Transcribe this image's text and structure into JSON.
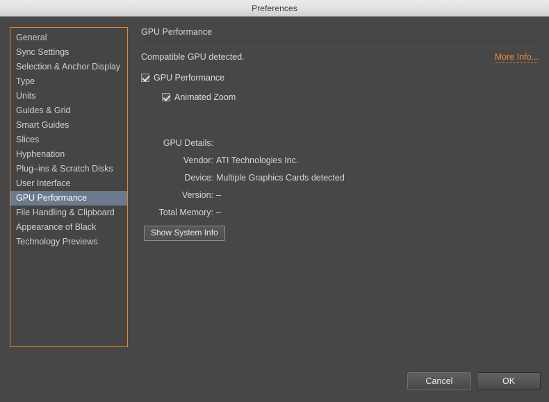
{
  "window": {
    "title": "Preferences"
  },
  "sidebar": {
    "selected": "GPU Performance",
    "items": [
      {
        "label": "General"
      },
      {
        "label": "Sync Settings"
      },
      {
        "label": "Selection & Anchor Display"
      },
      {
        "label": "Type"
      },
      {
        "label": "Units"
      },
      {
        "label": "Guides & Grid"
      },
      {
        "label": "Smart Guides"
      },
      {
        "label": "Slices"
      },
      {
        "label": "Hyphenation"
      },
      {
        "label": "Plug–ins & Scratch Disks"
      },
      {
        "label": "User Interface"
      },
      {
        "label": "GPU Performance"
      },
      {
        "label": "File Handling & Clipboard"
      },
      {
        "label": "Appearance of Black"
      },
      {
        "label": "Technology Previews"
      }
    ]
  },
  "main": {
    "header": "GPU Performance",
    "status_text": "Compatible GPU detected.",
    "more_info_label": "More Info...",
    "checkboxes": [
      {
        "label": "GPU Performance",
        "checked": true
      },
      {
        "label": "Animated Zoom",
        "checked": true
      }
    ],
    "details_title": "GPU Details:",
    "details": [
      {
        "label": "Vendor:",
        "value": "ATI Technologies Inc."
      },
      {
        "label": "Device:",
        "value": "Multiple Graphics Cards detected"
      },
      {
        "label": "Version:",
        "value": "–"
      },
      {
        "label": "Total Memory:",
        "value": "–"
      }
    ],
    "show_system_info_label": "Show System Info"
  },
  "footer": {
    "cancel_label": "Cancel",
    "ok_label": "OK"
  },
  "colors": {
    "accent_orange": "#e8872f",
    "selection_blue": "#6b7a8c",
    "background": "#474747",
    "titlebar": "#e2e2e2"
  }
}
